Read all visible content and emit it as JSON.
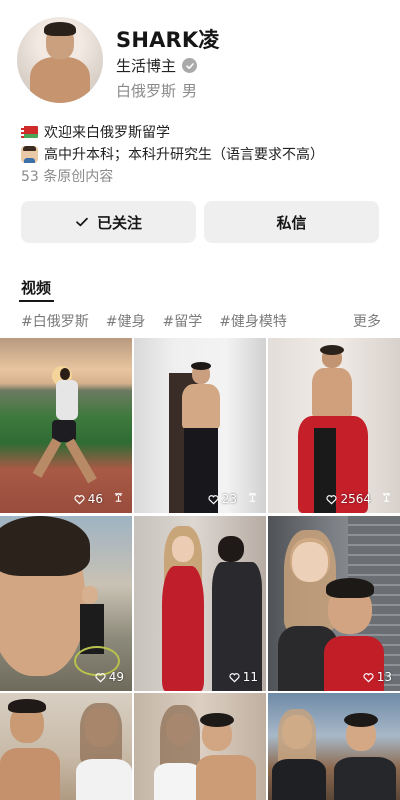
{
  "profile": {
    "name": "SHARK凌",
    "role": "生活博主",
    "location": "白俄罗斯",
    "gender": "男"
  },
  "bio": {
    "line1": "欢迎来白俄罗斯留学",
    "line2": "高中升本科；本科升研究生（语言要求不高）",
    "count": "53 条原创内容"
  },
  "actions": {
    "follow": "已关注",
    "message": "私信"
  },
  "tabs": {
    "videos": "视频"
  },
  "tags": [
    "#白俄罗斯",
    "#健身",
    "#留学",
    "#健身模特"
  ],
  "tags_more": "更多",
  "grid": [
    {
      "likes": "46"
    },
    {
      "likes": "23"
    },
    {
      "likes": "2564"
    },
    {
      "likes": "49"
    },
    {
      "likes": "11"
    },
    {
      "likes": "13"
    },
    {
      "likes": ""
    },
    {
      "likes": ""
    },
    {
      "likes": ""
    }
  ],
  "colors": {
    "button_bg": "#efefef",
    "muted_text": "#8a8a8a",
    "tag_text": "#7b7b7b"
  }
}
